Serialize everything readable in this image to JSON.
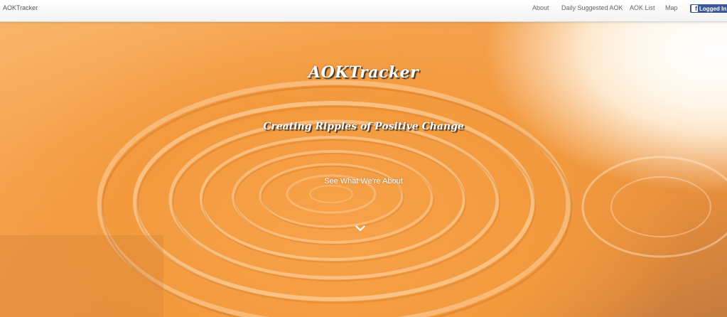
{
  "navbar": {
    "brand": "AOKTracker",
    "links": [
      {
        "label": "About"
      },
      {
        "label": "Daily Suggested AOK"
      },
      {
        "label": "AOK List"
      },
      {
        "label": "Map"
      }
    ],
    "login_button": {
      "icon": "facebook-icon",
      "label": "Logged In",
      "color": "#3b5998"
    }
  },
  "hero": {
    "title": "AOKTracker",
    "subtitle": "Creating Ripples of Positive Change",
    "cta": "See What We're About",
    "scroll_icon": "chevron-down-icon",
    "accent_color": "#f39a3e"
  }
}
